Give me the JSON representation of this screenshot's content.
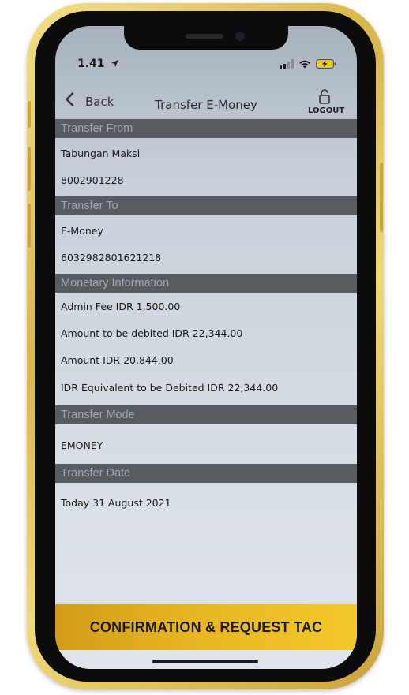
{
  "status": {
    "time": "1.41"
  },
  "nav": {
    "back_label": "Back",
    "title": "Transfer E-Money",
    "logout_label": "LOGOUT"
  },
  "sections": {
    "transfer_from": {
      "header": "Transfer From",
      "account_name": "Tabungan Maksi",
      "account_number": "8002901228"
    },
    "transfer_to": {
      "header": "Transfer To",
      "account_name": "E-Money",
      "account_number": "6032982801621218"
    },
    "monetary": {
      "header": "Monetary Information",
      "admin_fee": "Admin Fee IDR  1,500.00",
      "amount_debited": "Amount to be debited IDR  22,344.00",
      "amount": "Amount IDR  20,844.00",
      "idr_equivalent": "IDR Equivalent to be Debited IDR  22,344.00"
    },
    "transfer_mode": {
      "header": "Transfer Mode",
      "value": "EMONEY"
    },
    "transfer_date": {
      "header": "Transfer Date",
      "value": "Today 31 August 2021"
    }
  },
  "confirm_button": {
    "label": "CONFIRMATION & REQUEST TAC"
  },
  "colors": {
    "section_header_bg": "#575c61",
    "section_header_text": "#9ea6ad",
    "button_gold": "#e8b523",
    "frame_gold": "#d8b64a"
  },
  "icons": {
    "location_arrow": "location-arrow-icon",
    "signal": "cellular-signal-icon",
    "wifi": "wifi-icon",
    "battery": "battery-charging-icon",
    "back": "chevron-left-icon",
    "logout": "lock-icon"
  }
}
